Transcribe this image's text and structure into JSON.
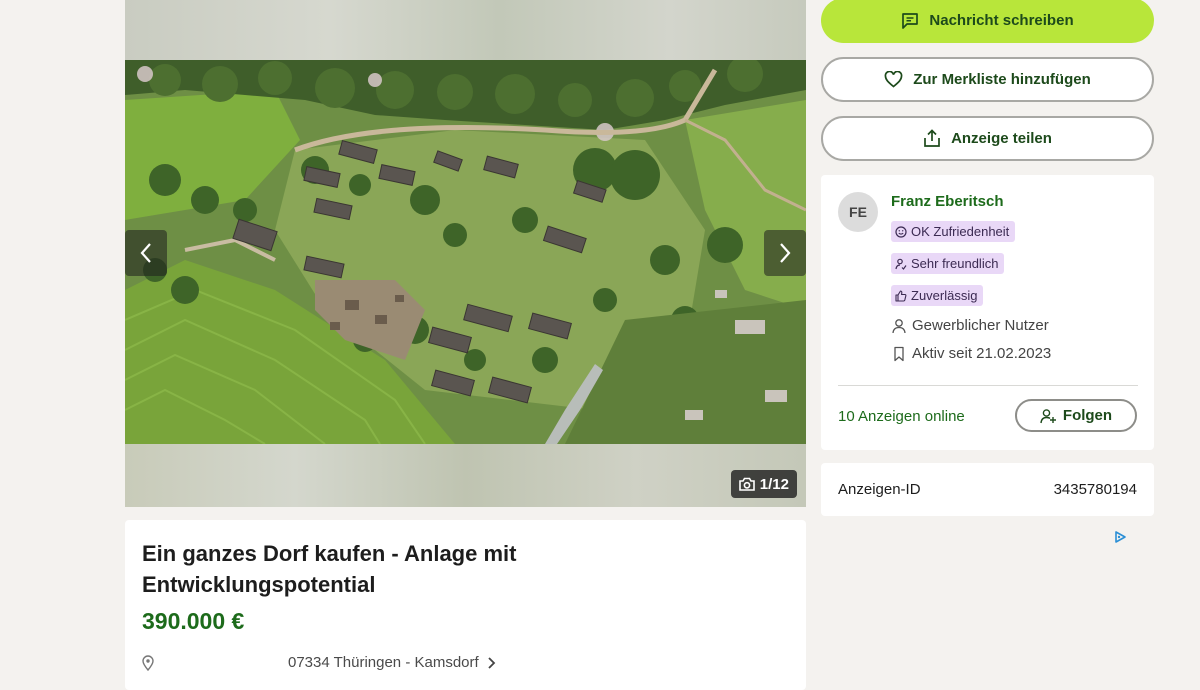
{
  "gallery": {
    "counter": "1/12",
    "prev_icon": "chevron-left-icon",
    "next_icon": "chevron-right-icon",
    "camera_icon": "camera-icon"
  },
  "listing": {
    "title": "Ein ganzes Dorf kaufen - Anlage mit Entwicklungspotential",
    "price": "390.000 €",
    "location": "07334 Thüringen - Kamsdorf"
  },
  "actions": {
    "message": "Nachricht schreiben",
    "watchlist": "Zur Merkliste hinzufügen",
    "share": "Anzeige teilen"
  },
  "seller": {
    "initials": "FE",
    "name": "Franz Eberitsch",
    "badges": [
      "OK Zufriedenheit",
      "Sehr freundlich",
      "Zuverlässig"
    ],
    "type": "Gewerblicher Nutzer",
    "active_since": "Aktiv seit 21.02.2023",
    "ads_online": "10 Anzeigen online",
    "follow": "Folgen"
  },
  "ad_id": {
    "label": "Anzeigen-ID",
    "value": "3435780194"
  },
  "colors": {
    "accent": "#b8e63a",
    "brand_green": "#1d6b1b",
    "badge_bg": "#e9d8f7",
    "background": "#f4f2ef"
  }
}
